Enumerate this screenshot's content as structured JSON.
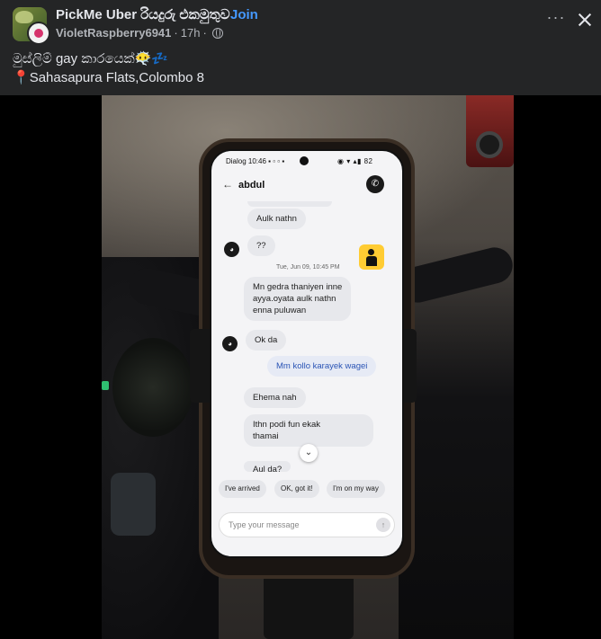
{
  "post": {
    "group_name": "PickMe Uber රියදුරු එකමුතුව",
    "dot": "·",
    "join_label": "Join",
    "author": "VioletRaspberry6941",
    "time": "17h",
    "meta_sep": "·",
    "more_label": "···",
    "caption_line1": "මුස්ලිම් gay කාරයෙක්😶‍🌫️💤",
    "caption_pin": "📍",
    "caption_line2": "Sahasapura Flats,Colombo 8"
  },
  "phone": {
    "status_left": "Dialog 10:46 ▪ ▫ ▫ ▪",
    "status_right": "◉ ▾ ▴▮ 82",
    "contact_name": "abdul",
    "back_icon": "←",
    "call_icon": "✆",
    "messages": [
      {
        "dir": "in",
        "text": "Aulk nathn"
      },
      {
        "dir": "in",
        "text": "??"
      },
      {
        "dir": "in",
        "lines": [
          "Mn gedra thaniyen inne",
          "ayya.oyata aulk nathn",
          "enna puluwan"
        ]
      },
      {
        "dir": "in",
        "text": "Ok da"
      },
      {
        "dir": "out",
        "text": "Mm kollo karayek wagei"
      },
      {
        "dir": "in",
        "text": "Ehema nah"
      },
      {
        "dir": "in",
        "lines": [
          "Ithn podi fun ekak",
          "thamai"
        ]
      },
      {
        "dir": "in",
        "text": "Aul da?"
      }
    ],
    "timestamp": "Tue, Jun 09, 10:45 PM",
    "avatar_glyph": "◕",
    "scroll_icon": "⌄",
    "quick_replies": [
      "I've arrived",
      "OK, got it!",
      "I'm on my way"
    ],
    "composer_placeholder": "Type your message",
    "send_icon": "↑"
  },
  "colors": {
    "background": "#242526",
    "link": "#4599ff",
    "text": "#e4e6eb",
    "muted": "#b0b3b8",
    "uber_yellow": "#ffcc33"
  }
}
